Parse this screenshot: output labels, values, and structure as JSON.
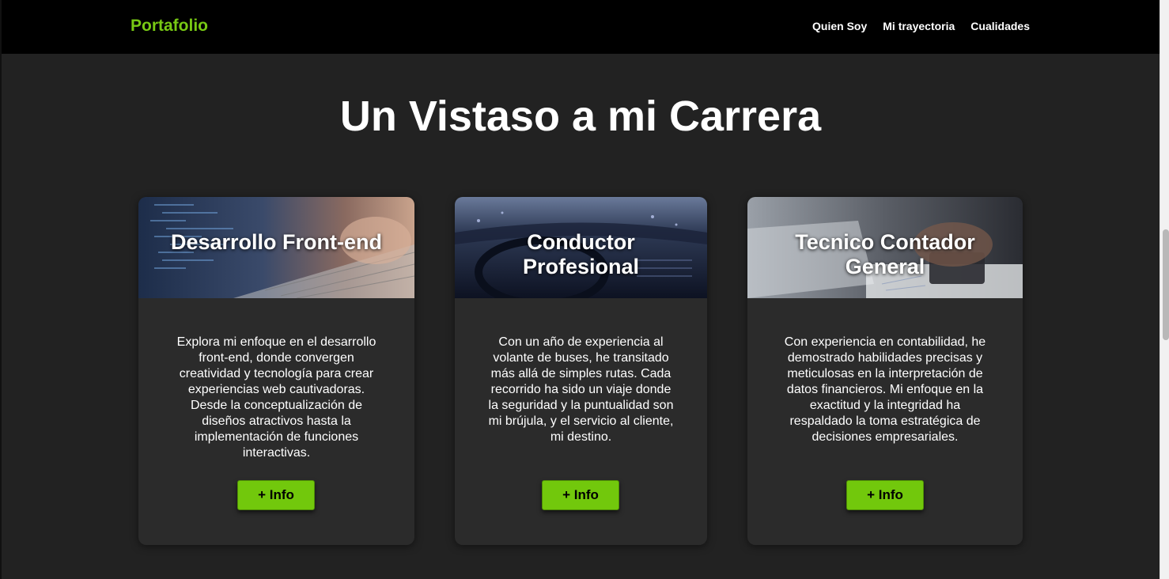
{
  "nav": {
    "brand": "Portafolio",
    "links": [
      "Quien Soy",
      "Mi trayectoria",
      "Cualidades"
    ]
  },
  "main": {
    "title": "Un Vistaso a mi Carrera",
    "cards": [
      {
        "title": "Desarrollo Front-end",
        "text": "Explora mi enfoque en el desarrollo front-end, donde convergen creatividad y tecnología para crear experiencias web cautivadoras. Desde la conceptualización de diseños atractivos hasta la implementación de funciones interactivas.",
        "button": "+ Info"
      },
      {
        "title": "Conductor Profesional",
        "text": "Con un año de experiencia al volante de buses, he transitado más allá de simples rutas. Cada recorrido ha sido un viaje donde la seguridad y la puntualidad son mi brújula, y el servicio al cliente, mi destino.",
        "button": "+ Info"
      },
      {
        "title": "Tecnico Contador General",
        "text": "Con experiencia en contabilidad, he demostrado habilidades precisas y meticulosas en la interpretación de datos financieros. Mi enfoque en la exactitud y la integridad ha respaldado la toma estratégica de decisiones empresariales.",
        "button": "+ Info"
      }
    ]
  },
  "colors": {
    "accent": "#78c914",
    "button": "#72c80c",
    "background": "#222222",
    "card": "#2b2b2b",
    "navbar": "#000000"
  }
}
